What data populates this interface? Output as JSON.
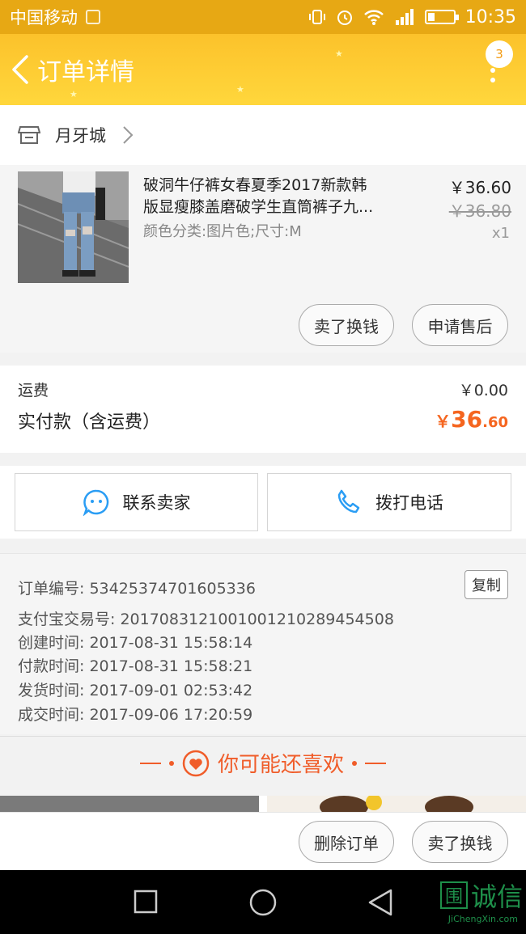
{
  "status_bar": {
    "carrier": "中国移动",
    "time": "10:35"
  },
  "header": {
    "title": "订单详情",
    "badge_count": "3"
  },
  "shop": {
    "name": "月牙城"
  },
  "product": {
    "title_line1": "破洞牛仔裤女春夏季2017新款韩",
    "title_line2": "版显瘦膝盖磨破学生直筒裤子九...",
    "spec": "颜色分类:图片色;尺寸:M",
    "price": "￥36.60",
    "original_price": "￥36.80",
    "quantity": "x1",
    "action_sell": "卖了换钱",
    "action_aftersale": "申请售后"
  },
  "fees": {
    "shipping_label": "运费",
    "shipping_value": "￥0.00",
    "paid_label": "实付款（含运费）",
    "paid_currency": "￥",
    "paid_int": "36",
    "paid_dec": ".60"
  },
  "contact": {
    "seller_label": "联系卖家",
    "phone_label": "拨打电话"
  },
  "order_info": {
    "order_no": "订单编号: 53425374701605336",
    "copy_label": "复制",
    "alipay_no": "支付宝交易号: 2017083121001001210289454508",
    "created": "创建时间: 2017-08-31 15:58:14",
    "paid": "付款时间: 2017-08-31 15:58:21",
    "shipped": "发货时间: 2017-09-01 02:53:42",
    "completed": "成交时间: 2017-09-06 17:20:59"
  },
  "recommend": {
    "title": "你可能还喜欢"
  },
  "bottom_actions": {
    "delete_label": "删除订单",
    "sell_label": "卖了换钱"
  },
  "watermark": {
    "mark": "围",
    "text": "诚信",
    "domain": "JiChengXin.com"
  },
  "colors": {
    "header": "#fcc22b",
    "status_bar": "#e7a814",
    "price_accent": "#f5651f",
    "recommend": "#f05d2a",
    "icon_blue": "#2a9df4"
  }
}
